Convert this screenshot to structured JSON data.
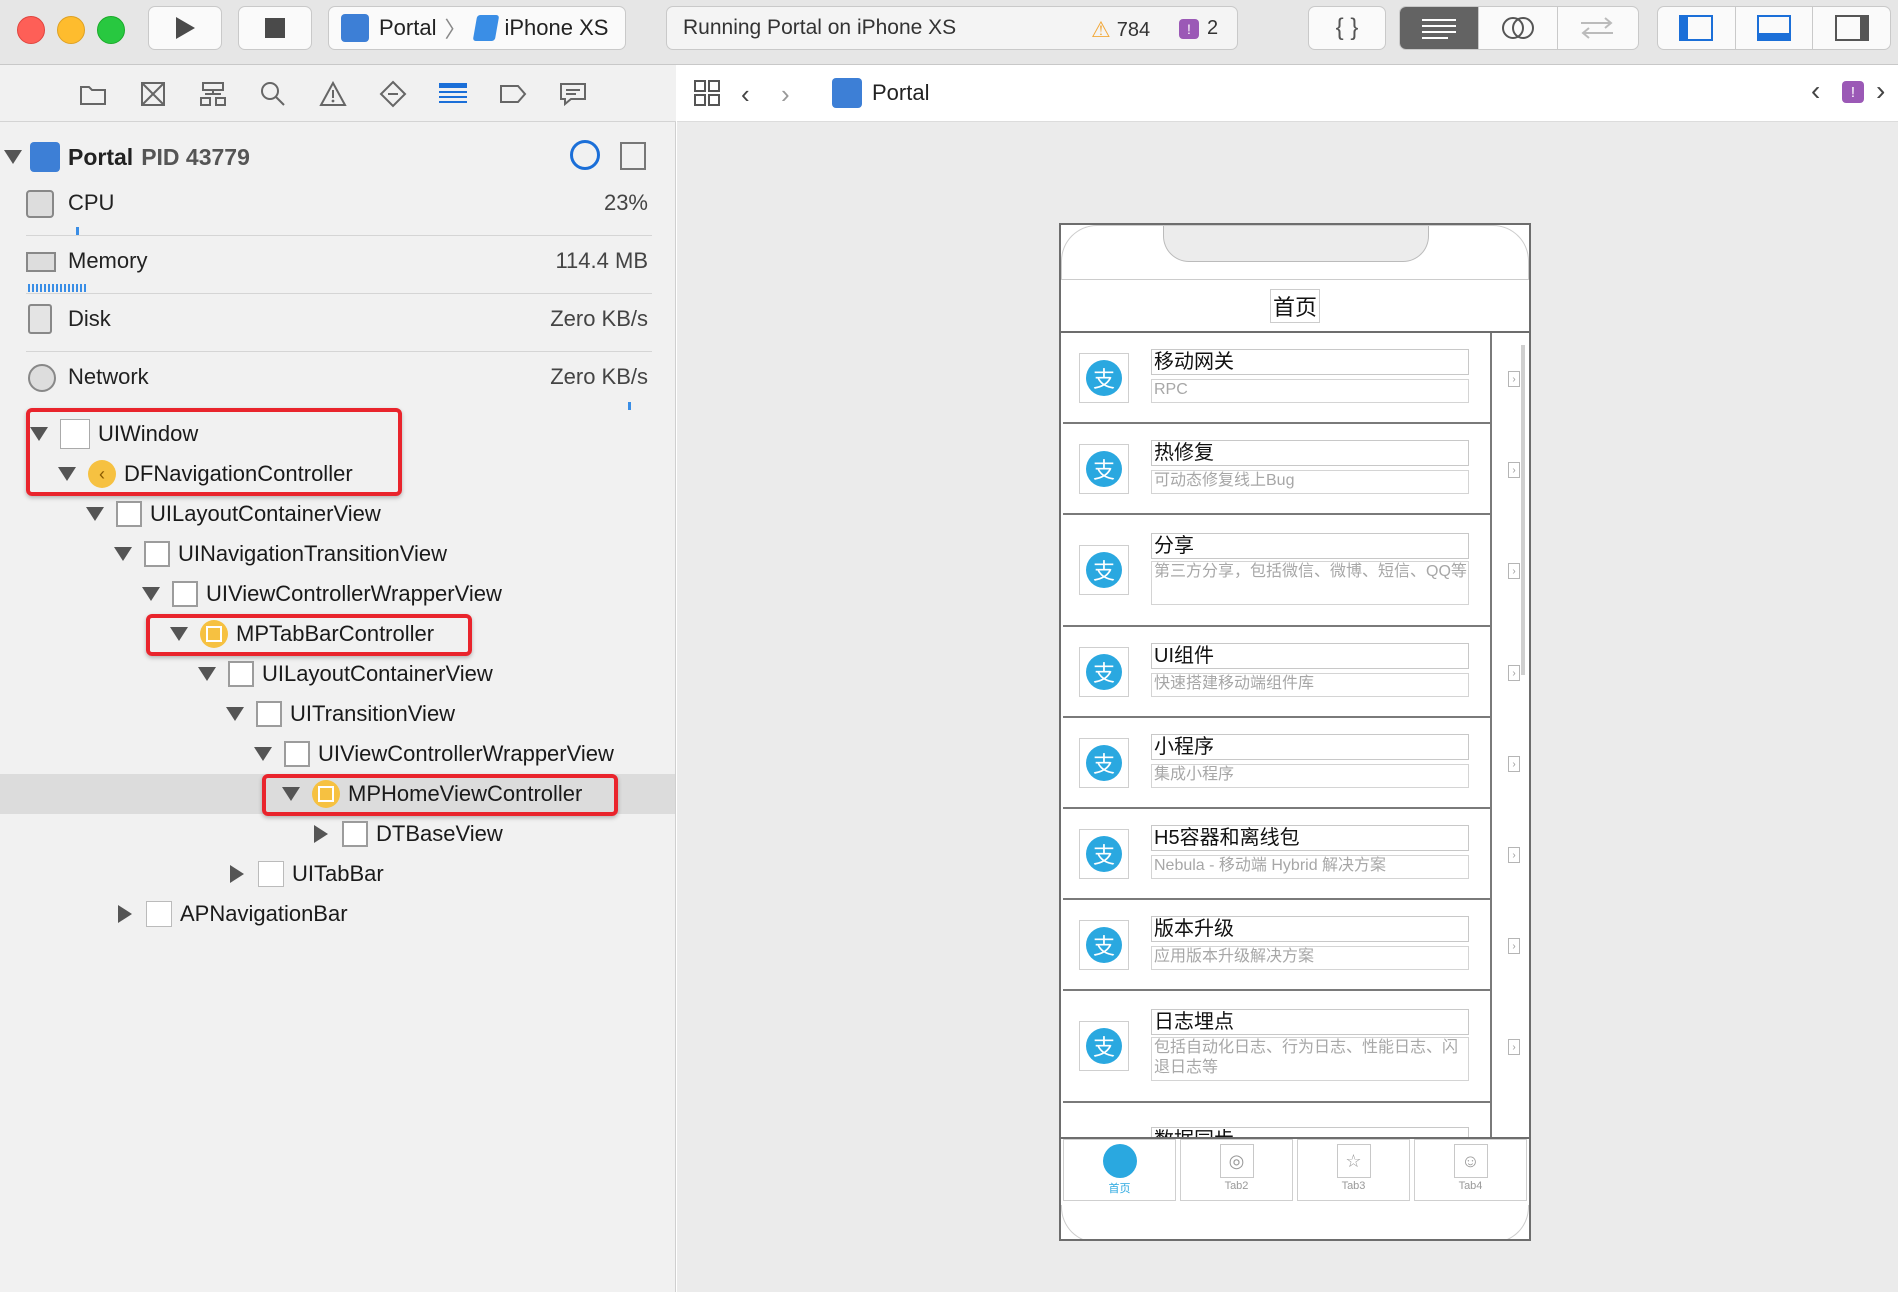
{
  "toolbar": {
    "scheme_target": "Portal",
    "scheme_device": "iPhone XS",
    "status_text": "Running Portal on iPhone XS",
    "warnings_count": "784",
    "issues_count": "2",
    "colors": {
      "close": "#fe5f57",
      "minimize": "#febc2e",
      "zoom": "#28c840"
    }
  },
  "process": {
    "name": "Portal",
    "pid_label": "PID 43779"
  },
  "gauges": [
    {
      "label": "CPU",
      "value": "23%",
      "icon": "cpu-icon"
    },
    {
      "label": "Memory",
      "value": "114.4 MB",
      "icon": "memory-icon"
    },
    {
      "label": "Disk",
      "value": "Zero KB/s",
      "icon": "disk-icon"
    },
    {
      "label": "Network",
      "value": "Zero KB/s",
      "icon": "network-icon"
    }
  ],
  "tree": [
    {
      "label": "UIWindow"
    },
    {
      "label": "DFNavigationController"
    },
    {
      "label": "UILayoutContainerView"
    },
    {
      "label": "UINavigationTransitionView"
    },
    {
      "label": "UIViewControllerWrapperView"
    },
    {
      "label": "MPTabBarController"
    },
    {
      "label": "UILayoutContainerView"
    },
    {
      "label": "UITransitionView"
    },
    {
      "label": "UIViewControllerWrapperView"
    },
    {
      "label": "MPHomeViewController"
    },
    {
      "label": "DTBaseView"
    },
    {
      "label": "UITabBar"
    },
    {
      "label": "APNavigationBar"
    }
  ],
  "jumpbar": {
    "crumb": "Portal"
  },
  "phone": {
    "nav_title": "首页",
    "badge_glyph": "支",
    "rows": [
      {
        "title": "移动网关",
        "subtitle": "RPC"
      },
      {
        "title": "热修复",
        "subtitle": "可动态修复线上Bug"
      },
      {
        "title": "分享",
        "subtitle": "第三方分享，包括微信、微博、短信、QQ等"
      },
      {
        "title": "UI组件",
        "subtitle": "快速搭建移动端组件库"
      },
      {
        "title": "小程序",
        "subtitle": "集成小程序"
      },
      {
        "title": "H5容器和离线包",
        "subtitle": "Nebula - 移动端 Hybrid 解决方案"
      },
      {
        "title": "版本升级",
        "subtitle": "应用版本升级解决方案"
      },
      {
        "title": "日志埋点",
        "subtitle": "包括自动化日志、行为日志、性能日志、闪退日志等"
      },
      {
        "title": "数据同步",
        "subtitle": ""
      }
    ],
    "tabs": [
      {
        "label": "首页"
      },
      {
        "label": "Tab2"
      },
      {
        "label": "Tab3"
      },
      {
        "label": "Tab4"
      }
    ]
  }
}
